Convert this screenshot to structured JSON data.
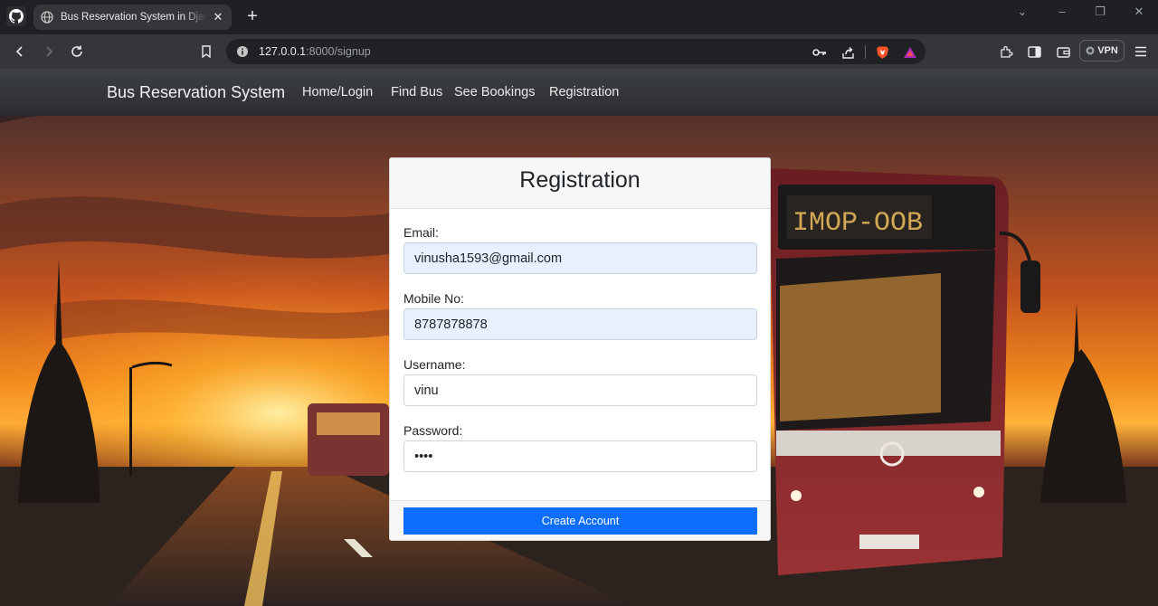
{
  "browser": {
    "tab": {
      "title": "Bus Reservation System in Django"
    },
    "address": {
      "host": "127.0.0.1",
      "rest": ":8000/signup"
    },
    "vpn_label": "VPN"
  },
  "navbar": {
    "brand": "Bus Reservation System",
    "links": [
      "Home/Login",
      "Find Bus",
      "See Bookings",
      "Registration"
    ]
  },
  "form": {
    "title": "Registration",
    "email": {
      "label": "Email:",
      "value": "vinusha1593@gmail.com"
    },
    "mobile": {
      "label": "Mobile No:",
      "value": "8787878878"
    },
    "username": {
      "label": "Username:",
      "value": "vinu"
    },
    "password": {
      "label": "Password:",
      "value": "vinu"
    },
    "submit_label": "Create Account"
  },
  "colors": {
    "primary": "#0d6efd",
    "autofill": "#e8f0fe",
    "navbar": "#34373b"
  },
  "icons": [
    "github-icon",
    "globe-icon",
    "close-icon",
    "plus-icon",
    "back-icon",
    "forward-icon",
    "reload-icon",
    "bookmark-icon",
    "info-icon",
    "key-icon",
    "share-icon",
    "brave-shield-icon",
    "brave-rewards-icon",
    "extensions-icon",
    "sidebar-icon",
    "wallet-icon",
    "menu-icon"
  ]
}
